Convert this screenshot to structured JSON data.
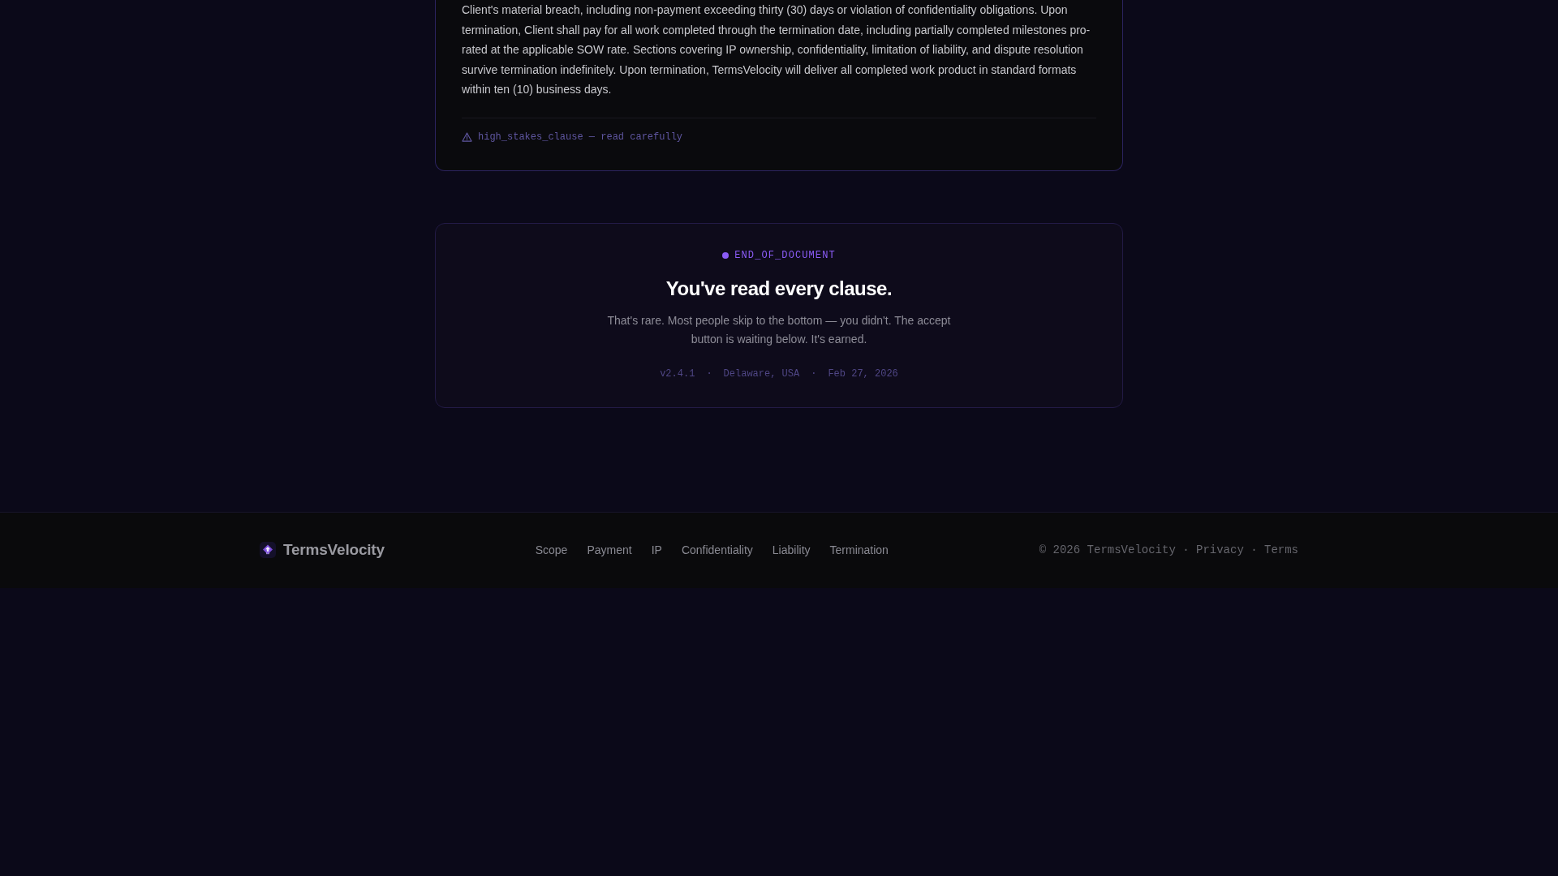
{
  "clause_card": {
    "body": "Client's material breach, including non-payment exceeding thirty (30) days or violation of confidentiality obligations. Upon termination, Client shall pay for all work completed through the termination date, including partially completed milestones pro-rated at the applicable SOW rate. Sections covering IP ownership, confidentiality, limitation of liability, and dispute resolution survive termination indefinitely. Upon termination, TermsVelocity will deliver all completed work product in standard formats within ten (10) business days.",
    "footnote": "high_stakes_clause — read carefully"
  },
  "end_card": {
    "tag": "END_OF_DOCUMENT",
    "title": "You've read every clause.",
    "message": "That's rare. Most people skip to the bottom — you didn't. The accept button is waiting below. It's earned.",
    "meta": [
      "v2.4.1",
      "Delaware, USA",
      "Feb 27, 2026"
    ],
    "meta_separator": "·"
  },
  "footer": {
    "brand": "TermsVelocity",
    "nav": [
      "Scope",
      "Payment",
      "IP",
      "Confidentiality",
      "Liability",
      "Termination"
    ],
    "copyright": "© 2026 TermsVelocity",
    "links": [
      "Privacy",
      "Terms"
    ],
    "separator": "·"
  }
}
